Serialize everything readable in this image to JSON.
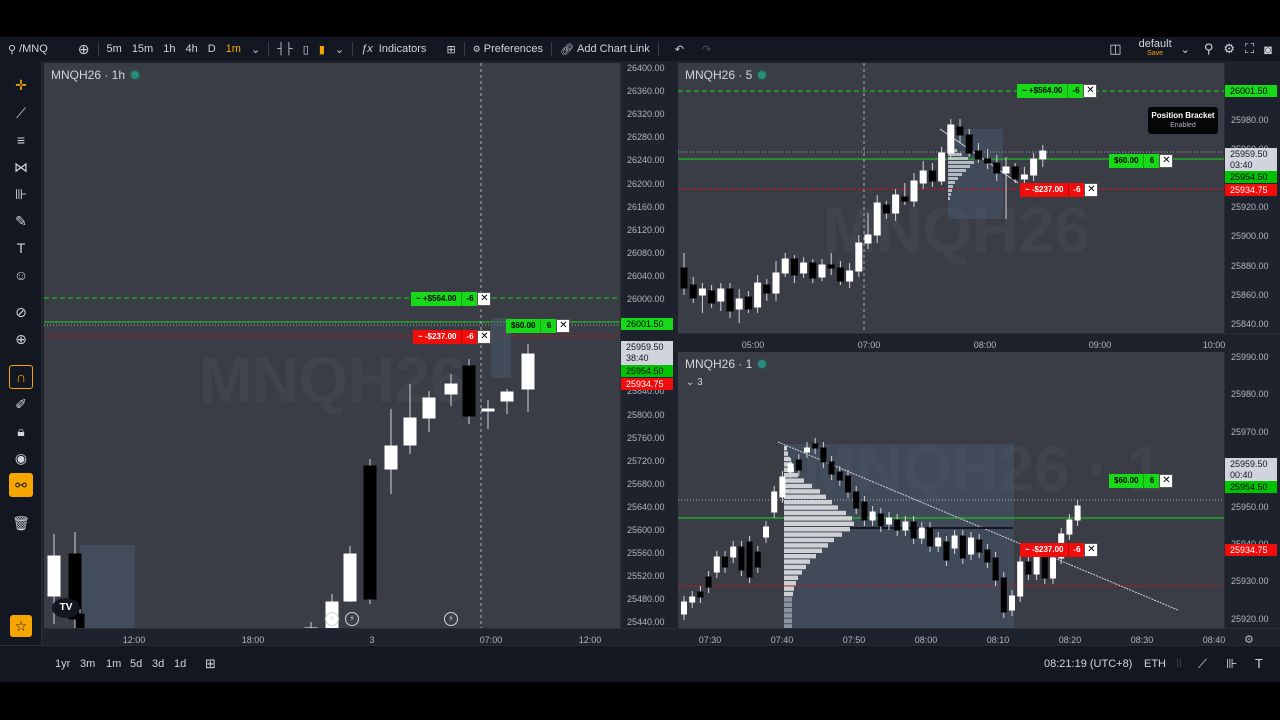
{
  "toolbar": {
    "symbol": "/MNQ",
    "intervals": [
      "5m",
      "15m",
      "1h",
      "4h",
      "D",
      "1m"
    ],
    "active_interval": "1m",
    "indicators_label": "Indicators",
    "preferences_label": "Preferences",
    "chart_link_label": "Add Chart Link",
    "layout_name": "default",
    "layout_save": "Save"
  },
  "tooltip": {
    "title": "Position Bracket",
    "subtitle": "Enabled"
  },
  "pane_left": {
    "title": "MNQH26 · 1h",
    "watermark": "MNQH26",
    "y_ticks": [
      "26400.00",
      "26360.00",
      "26320.00",
      "26280.00",
      "26240.00",
      "26200.00",
      "26160.00",
      "26120.00",
      "26080.00",
      "26040.00",
      "26000.00",
      "25960.00",
      "25920.00",
      "25880.00",
      "25840.00",
      "25800.00",
      "25760.00",
      "25720.00",
      "25680.00",
      "25640.00",
      "25600.00",
      "25560.00",
      "25520.00",
      "25480.00",
      "25440.00"
    ],
    "x_ticks": [
      "12:00",
      "18:00",
      "3",
      "07:00",
      "12:00"
    ],
    "tp_price": "26001.50",
    "current_price": "25959.50",
    "countdown": "38:40",
    "entry_price": "25954.50",
    "stop_price": "25934.75",
    "tp_order": {
      "label": "~ +$564.00",
      "qty": "-6"
    },
    "stop_order": {
      "label": "~ -$237.00",
      "qty": "-6"
    },
    "pos_order": {
      "label": "$60.00",
      "qty": "6"
    }
  },
  "pane_tr": {
    "title": "MNQH26 · 5",
    "watermark": "MNQH26",
    "y_ticks": [
      "25980.00",
      "25960.00",
      "25940.00",
      "25920.00",
      "25900.00",
      "25880.00",
      "25860.00",
      "25840.00"
    ],
    "x_ticks": [
      "05:00",
      "07:00",
      "08:00",
      "09:00",
      "10:00"
    ],
    "tp_price": "26001.50",
    "current_price": "25959.50",
    "countdown": "03:40",
    "entry_price": "25954.50",
    "stop_price": "25934.75",
    "tp_order": {
      "label": "~ +$564.00",
      "qty": "-6"
    },
    "stop_order": {
      "label": "~ -$237.00",
      "qty": "-6"
    },
    "pos_order": {
      "label": "$60.00",
      "qty": "6"
    }
  },
  "pane_br": {
    "title": "MNQH26 · 1",
    "collapse_count": "3",
    "watermark": "MNQH26 · 1",
    "y_ticks": [
      "25990.00",
      "25980.00",
      "25970.00",
      "25960.00",
      "25950.00",
      "25940.00",
      "25930.00",
      "25920.00"
    ],
    "x_ticks": [
      "07:30",
      "07:40",
      "07:50",
      "08:00",
      "08:10",
      "08:20",
      "08:30",
      "08:40"
    ],
    "current_price": "25959.50",
    "countdown": "00:40",
    "entry_price": "25954.50",
    "stop_price": "25934.75",
    "stop_order": {
      "label": "~ -$237.00",
      "qty": "-6"
    },
    "pos_order": {
      "label": "$60.00",
      "qty": "6"
    }
  },
  "bottombar": {
    "ranges": [
      "1yr",
      "3m",
      "1m",
      "5d",
      "3d",
      "1d"
    ],
    "clock": "08:21:19 (UTC+8)",
    "session": "ETH"
  },
  "colors": {
    "accent": "#f7a600",
    "profit": "#17d917",
    "loss": "#f20d0d",
    "pane_bg": "#3a3d45"
  }
}
